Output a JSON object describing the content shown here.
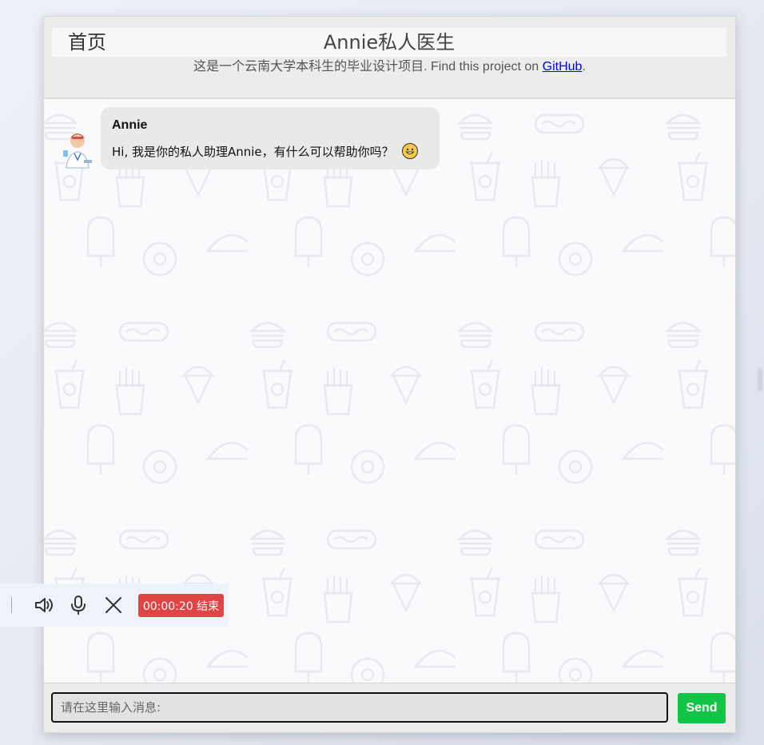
{
  "header": {
    "home_label": "首页",
    "title": "Annie私人医生",
    "subtitle_prefix": "这是一个云南大学本科生的毕业设计项目. Find this project on ",
    "github_link": "GitHub",
    "subtitle_suffix": "."
  },
  "chat": {
    "messages": [
      {
        "sender": "Annie",
        "text": "Hi, 我是你的私人助理Annie，有什么可以帮助你吗？",
        "emoji": "grinning-face"
      }
    ]
  },
  "input": {
    "placeholder": "请在这里输入消息:",
    "value": "",
    "send_label": "Send"
  },
  "call_bar": {
    "timer": "00:00:20",
    "end_label": "结束",
    "timer_label": "00:00:20 结束"
  },
  "colors": {
    "send_button": "#12c645",
    "end_button": "#e04444",
    "bubble": "#e9e9e9",
    "header_bg": "#ececec"
  }
}
